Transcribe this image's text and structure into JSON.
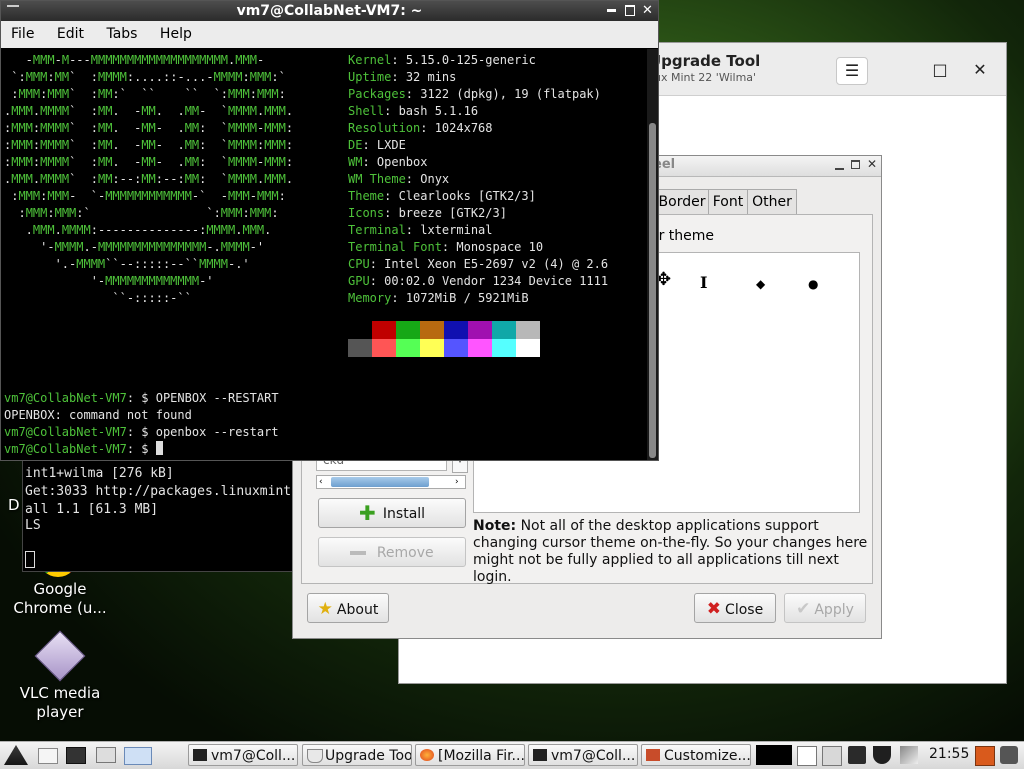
{
  "desktop": {
    "partial_letter": "D",
    "icons": [
      {
        "label_line1": "Google",
        "label_line2": "Chrome (u..."
      },
      {
        "label_line1": "VLC media",
        "label_line2": "player"
      }
    ],
    "small_terminal_lines": [
      "int1+wilma [276 kB]",
      "Get:3033 http://packages.linuxmint",
      "all 1.1 [61.3 MB]",
      "LS"
    ]
  },
  "upgrade_tool": {
    "title": "Upgrade Tool",
    "subtitle": "ux Mint 22 'Wilma'",
    "menu_glyph": "☰",
    "maximize_glyph": "□",
    "close_glyph": "✕"
  },
  "customize": {
    "title_fragment": "eel",
    "tabs": [
      "Border",
      "Font",
      "Other"
    ],
    "cursor_label": "or theme",
    "cursor_glyphs": [
      "✥",
      "I",
      "◆",
      "●"
    ],
    "input_fragment": "ckd",
    "install_label": "Install",
    "remove_label": "Remove",
    "note_bold": "Note:",
    "note_text": " Not all of the desktop applications support changing cursor theme on-the-fly. So your changes here might not be fully applied to all applications till next login.",
    "about_label": "About",
    "close_label": "Close",
    "apply_label": "Apply"
  },
  "terminal": {
    "title": "vm7@CollabNet-VM7: ~",
    "menu": [
      "File",
      "Edit",
      "Tabs",
      "Help"
    ],
    "logo": [
      "   -MMM-M---MMMMMMMMMMMMMMMMMMM.MMM-",
      " `:MMM:MM`  :MMMM:....::-...-MMMM:MMM:`",
      " :MMM:MMM`  :MM:`  ``    ``  `:MMM:MMM:",
      ".MMM.MMMM`  :MM.  -MM.  .MM-  `MMMM.MMM.",
      ":MMM:MMMM`  :MM.  -MM-  .MM:  `MMMM-MMM:",
      ":MMM:MMMM`  :MM.  -MM-  .MM:  `MMMM:MMM:",
      ":MMM:MMMM`  :MM.  -MM-  .MM:  `MMMM-MMM:",
      ".MMM.MMMM`  :MM:--:MM:--:MM:  `MMMM.MMM.",
      " :MMM:MMM-  `-MMMMMMMMMMMM-`  -MMM-MMM:",
      "  :MMM:MMM:`                `:MMM:MMM:",
      "   .MMM.MMMM:--------------:MMMM.MMM.",
      "     '-MMMM.-MMMMMMMMMMMMMMM-.MMMM-'",
      "       '.-MMMM``--:::::--``MMMM-.'",
      "            '-MMMMMMMMMMMMM-'",
      "               ``-:::::-``"
    ],
    "info": [
      {
        "k": "Kernel",
        "v": "5.15.0-125-generic"
      },
      {
        "k": "Uptime",
        "v": "32 mins"
      },
      {
        "k": "Packages",
        "v": "3122 (dpkg), 19 (flatpak)"
      },
      {
        "k": "Shell",
        "v": "bash 5.1.16"
      },
      {
        "k": "Resolution",
        "v": "1024x768"
      },
      {
        "k": "DE",
        "v": "LXDE"
      },
      {
        "k": "WM",
        "v": "Openbox"
      },
      {
        "k": "WM Theme",
        "v": "Onyx"
      },
      {
        "k": "Theme",
        "v": "Clearlooks [GTK2/3]"
      },
      {
        "k": "Icons",
        "v": "breeze [GTK2/3]"
      },
      {
        "k": "Terminal",
        "v": "lxterminal"
      },
      {
        "k": "Terminal Font",
        "v": "Monospace 10"
      },
      {
        "k": "CPU",
        "v": "Intel Xeon E5-2697 v2 (4) @ 2.6"
      },
      {
        "k": "GPU",
        "v": "00:02.0 Vendor 1234 Device 1111"
      },
      {
        "k": "Memory",
        "v": "1072MiB / 5921MiB"
      }
    ],
    "palette_top": [
      "#000000",
      "#c00000",
      "#16a816",
      "#b86a10",
      "#1010b0",
      "#a010b0",
      "#10a8a8",
      "#b8b8b8"
    ],
    "palette_bottom": [
      "#555555",
      "#ff5555",
      "#55ff55",
      "#ffff55",
      "#5555ff",
      "#ff55ff",
      "#55ffff",
      "#ffffff"
    ],
    "prompt": "vm7@CollabNet-VM7",
    "cmd1": "OPENBOX --RESTART",
    "out1": "OPENBOX: command not found",
    "cmd2": "openbox --restart"
  },
  "taskbar": {
    "tasks": [
      "vm7@Coll...",
      "Upgrade Tool",
      "[Mozilla Fir...",
      "vm7@Coll...",
      "Customize..."
    ],
    "clock": "21:55"
  }
}
